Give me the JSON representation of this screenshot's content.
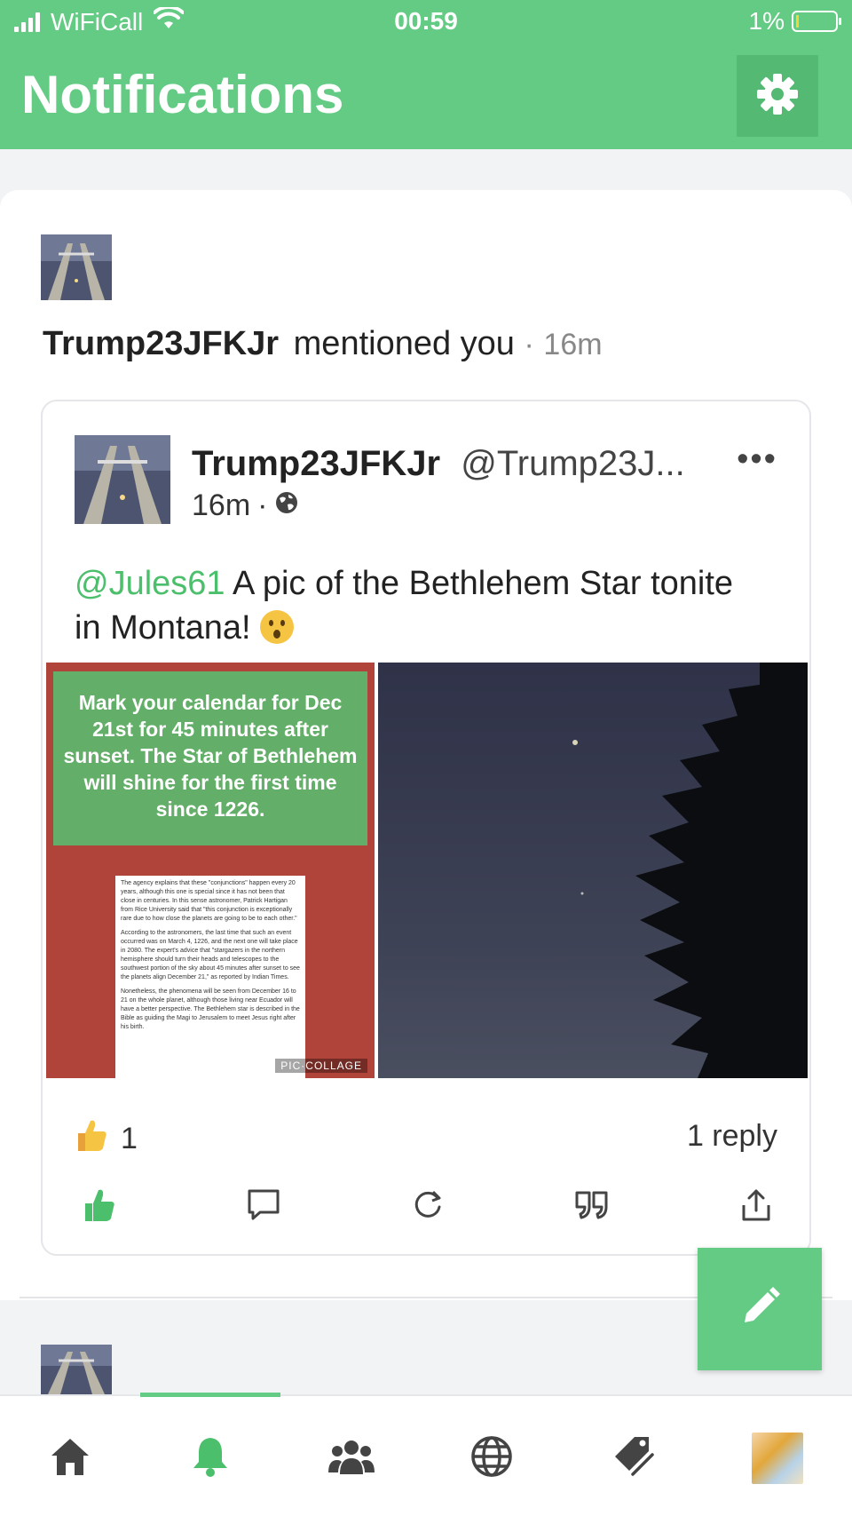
{
  "status_bar": {
    "carrier": "WiFiCall",
    "time": "00:59",
    "battery": "1%"
  },
  "header": {
    "title": "Notifications",
    "settings_icon": "gear-icon"
  },
  "notification": {
    "username": "Trump23JFKJr",
    "action": "mentioned you",
    "separator": "·",
    "time_ago": "16m"
  },
  "post": {
    "author_name": "Trump23JFKJr",
    "author_handle": "@Trump23J...",
    "more_label": "•••",
    "time": "16m",
    "meta_separator": "·",
    "visibility_icon": "globe-icon",
    "mention": "@Jules61",
    "text": " A pic of the Bethlehem Star tonite in Montana! ",
    "image_left": {
      "headline": "Mark your calendar for Dec 21st for 45 minutes after sunset. The Star of Bethlehem will shine for the first time since 1226.",
      "article_p1": "The agency explains that these \"conjunctions\" happen every 20 years, although this one is special since it has not been that close in centuries. In this sense astronomer, Patrick Hartigan from Rice University said that \"this conjunction is exceptionally rare due to how close the planets are going to be to each other.\"",
      "article_p2": "According to the astronomers, the last time that such an event occurred was on March 4, 1226, and the next one will take place in 2080. The expert's advice that \"stargazers in the northern hemisphere should turn their heads and telescopes to the southwest portion of the sky about 45 minutes after sunset to see the planets align December 21,\" as reported by Indian Times.",
      "article_p3": "Nonetheless, the phenomena will be seen from December 16 to 21 on the whole planet, although those living near Ecuador will have a better perspective. The Bethlehem star is described in the Bible as guiding the Magi to Jerusalem to meet Jesus right after his birth.",
      "watermark": "PIC·COLLAGE"
    },
    "reaction_count": "1",
    "reply_count": "1 reply",
    "actions": [
      "like-icon",
      "comment-icon",
      "reshare-icon",
      "quote-icon",
      "share-icon"
    ]
  },
  "fab_icon": "pencil-icon",
  "bottom_nav": [
    "home-icon",
    "bell-icon",
    "people-icon",
    "globe-icon",
    "tag-icon",
    "profile-avatar"
  ],
  "colors": {
    "accent": "#63cb83",
    "mention": "#4cbf6c"
  }
}
